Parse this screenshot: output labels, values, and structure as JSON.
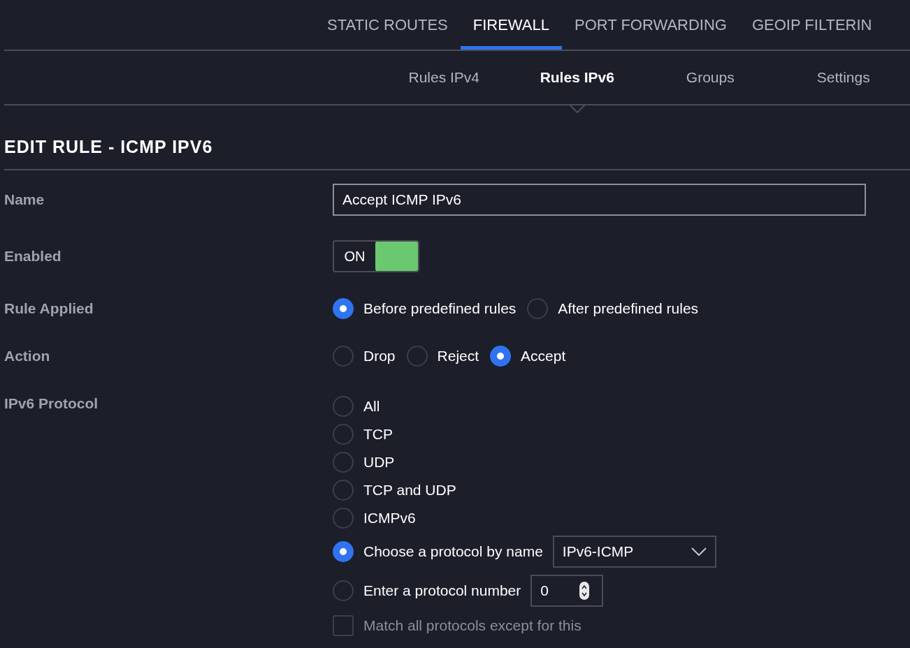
{
  "top_tabs": [
    {
      "label": "STATIC ROUTES",
      "selected": false
    },
    {
      "label": "FIREWALL",
      "selected": true
    },
    {
      "label": "PORT FORWARDING",
      "selected": false
    },
    {
      "label": "GEOIP FILTERIN",
      "selected": false
    }
  ],
  "sub_tabs": [
    {
      "label": "Rules IPv4",
      "selected": false
    },
    {
      "label": "Rules IPv6",
      "selected": true
    },
    {
      "label": "Groups",
      "selected": false
    },
    {
      "label": "Settings",
      "selected": false
    }
  ],
  "title": "EDIT RULE - ICMP IPV6",
  "fields": [
    {
      "kind": "text",
      "label": "Name",
      "value": "Accept ICMP IPv6"
    },
    {
      "kind": "toggle",
      "label": "Enabled",
      "on": true,
      "on_text": "ON"
    },
    {
      "kind": "radio_inline",
      "label": "Rule Applied",
      "options": [
        {
          "label": "Before predefined rules",
          "selected": true
        },
        {
          "label": "After predefined rules",
          "selected": false
        }
      ]
    },
    {
      "kind": "radio_inline",
      "label": "Action",
      "options": [
        {
          "label": "Drop",
          "selected": false
        },
        {
          "label": "Reject",
          "selected": false
        },
        {
          "label": "Accept",
          "selected": true
        }
      ]
    },
    {
      "kind": "radio_stack",
      "label": "IPv6 Protocol",
      "options": [
        {
          "label": "All",
          "selected": false
        },
        {
          "label": "TCP",
          "selected": false
        },
        {
          "label": "UDP",
          "selected": false
        },
        {
          "label": "TCP and UDP",
          "selected": false
        },
        {
          "label": "ICMPv6",
          "selected": false
        },
        {
          "label": "Choose a protocol by name",
          "selected": true,
          "select": {
            "value": "IPv6-ICMP"
          }
        },
        {
          "label": "Enter a protocol number",
          "selected": false,
          "number": {
            "value": "0"
          }
        }
      ],
      "checkbox": {
        "label": "Match all protocols except for this",
        "checked": false,
        "disabled": true
      }
    }
  ]
}
